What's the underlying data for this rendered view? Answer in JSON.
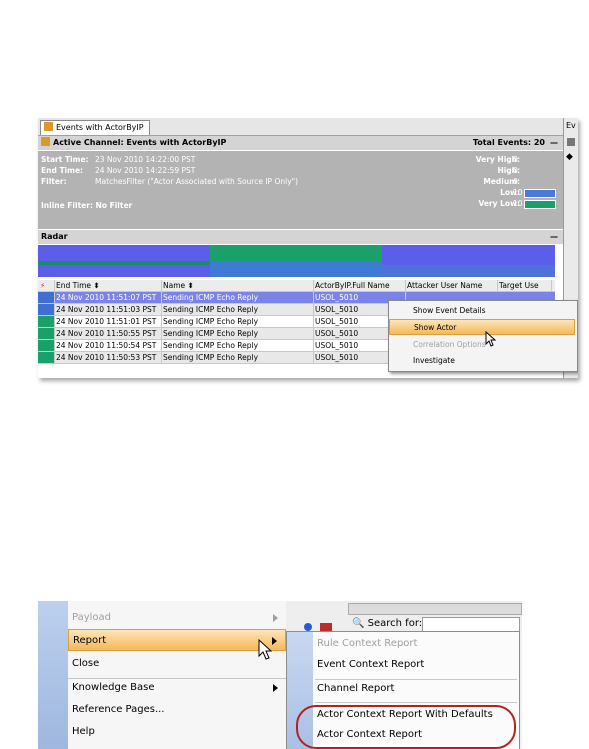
{
  "top": {
    "tab_label": "Events with ActorByIP",
    "right_tab_glimpse": "Ev",
    "channel_title": "Active Channel:  Events with ActorByIP",
    "total_events": "Total Events: 20",
    "start_time_label": "Start Time:",
    "start_time_value": "23 Nov 2010 14:22:00 PST",
    "end_time_label": "End Time:",
    "end_time_value": "24 Nov 2010 14:22:59 PST",
    "filter_label": "Filter:",
    "filter_value": "MatchesFilter (\"Actor Associated with Source IP Only\")",
    "inline_filter": "Inline Filter: No Filter",
    "severity": [
      {
        "label": "Very High:",
        "value": "0"
      },
      {
        "label": "High:",
        "value": "0"
      },
      {
        "label": "Medium:",
        "value": "0"
      },
      {
        "label": "Low:",
        "value": "10"
      },
      {
        "label": "Very Low:",
        "value": "10"
      }
    ],
    "low_color": "#4a7ad6",
    "verylow_color": "#1aa06a",
    "radar_label": "Radar",
    "columns": [
      "End Time ⬍",
      "Name ⬍",
      "ActorByIP.Full Name",
      "Attacker User Name",
      "Target Use"
    ],
    "rows": [
      {
        "time": "24 Nov 2010 11:51:07 PST",
        "name": "Sending ICMP Echo Reply",
        "actor": "USOL_5010"
      },
      {
        "time": "24 Nov 2010 11:51:03 PST",
        "name": "Sending ICMP Echo Reply",
        "actor": "USOL_5010"
      },
      {
        "time": "24 Nov 2010 11:51:01 PST",
        "name": "Sending ICMP Echo Reply",
        "actor": "USOL_5010"
      },
      {
        "time": "24 Nov 2010 11:50:55 PST",
        "name": "Sending ICMP Echo Reply",
        "actor": "USOL_5010"
      },
      {
        "time": "24 Nov 2010 11:50:54 PST",
        "name": "Sending ICMP Echo Reply",
        "actor": "USOL_5010"
      },
      {
        "time": "24 Nov 2010 11:50:53 PST",
        "name": "Sending ICMP Echo Reply",
        "actor": "USOL_5010"
      }
    ],
    "context_menu": [
      "Show Event Details",
      "Show Actor",
      "Correlation Options",
      "Investigate"
    ]
  },
  "bottom": {
    "menu": [
      "Payload",
      "Report",
      "Close",
      "Knowledge Base",
      "Reference Pages...",
      "Help"
    ],
    "submenu": [
      "Rule Context Report",
      "Event Context Report",
      "Channel Report",
      "Actor Context Report With Defaults",
      "Actor Context Report"
    ],
    "search_label": "Search for:"
  }
}
